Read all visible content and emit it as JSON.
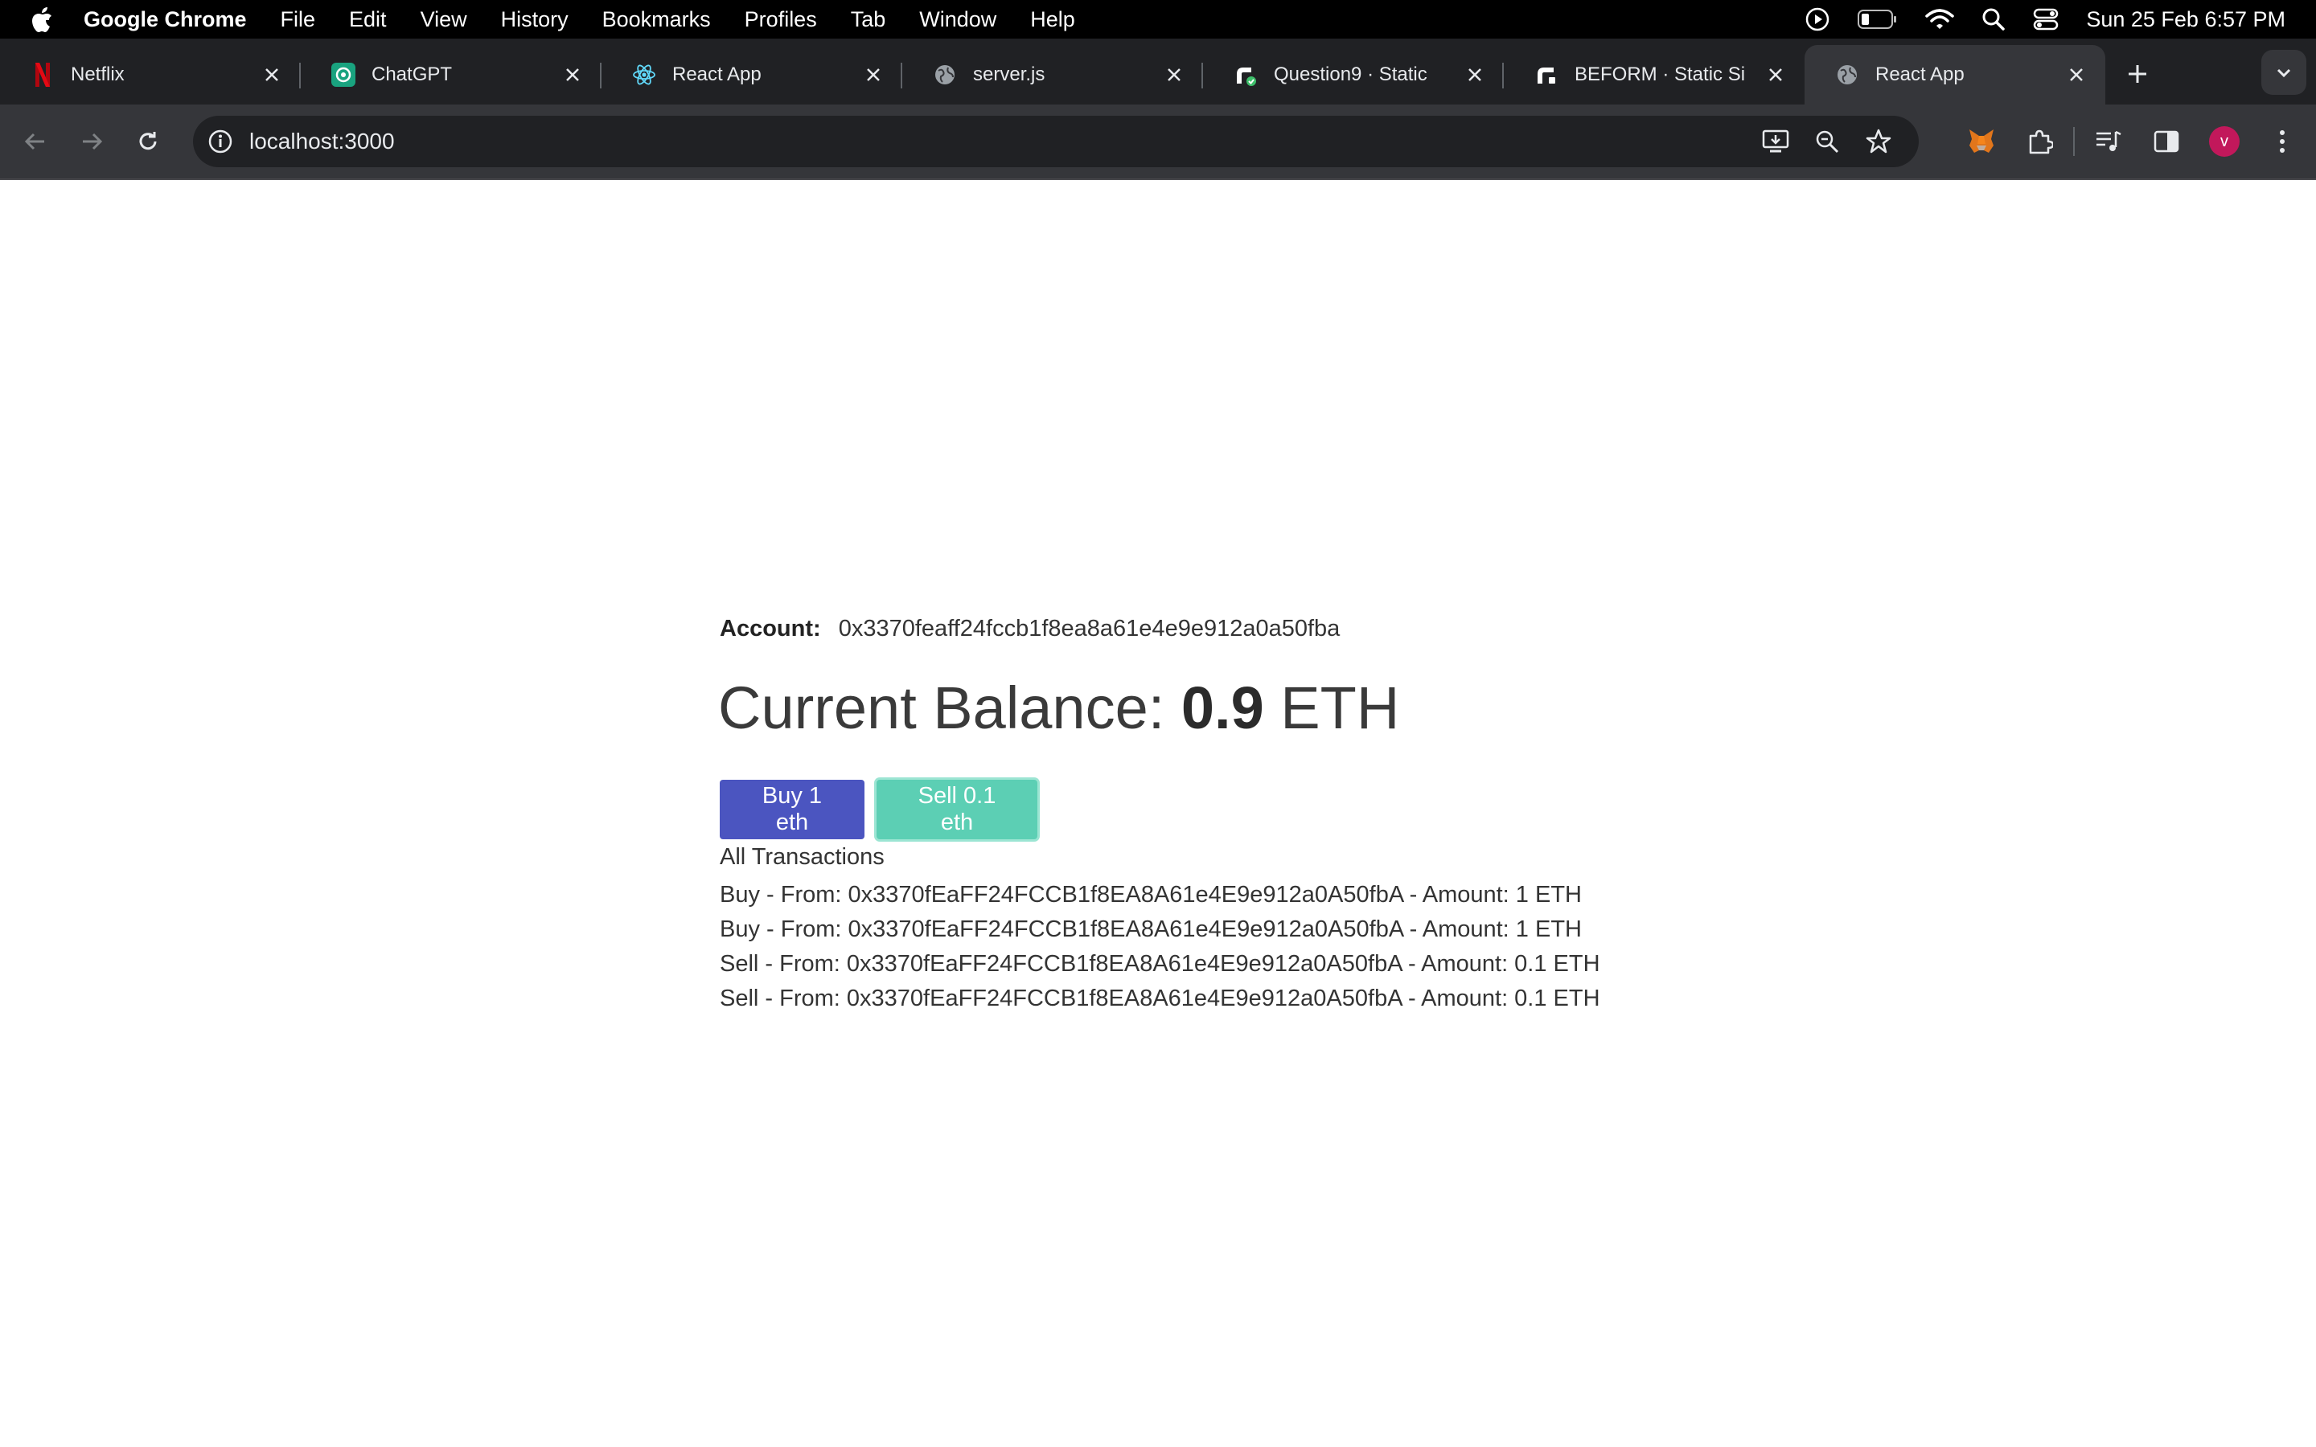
{
  "menubar": {
    "app_name": "Google Chrome",
    "items": [
      "File",
      "Edit",
      "View",
      "History",
      "Bookmarks",
      "Profiles",
      "Tab",
      "Window",
      "Help"
    ],
    "clock": "Sun 25 Feb  6:57 PM"
  },
  "tabs": [
    {
      "title": "Netflix",
      "icon": "netflix-icon",
      "active": false
    },
    {
      "title": "ChatGPT",
      "icon": "chatgpt-icon",
      "active": false
    },
    {
      "title": "React App",
      "icon": "react-icon",
      "active": false
    },
    {
      "title": "server.js",
      "icon": "globe-icon",
      "active": false
    },
    {
      "title": "Question9 · Static",
      "icon": "render-icon",
      "active": false
    },
    {
      "title": "BEFORM · Static Si",
      "icon": "render-icon",
      "active": false
    },
    {
      "title": "React App",
      "icon": "globe-icon",
      "active": true
    }
  ],
  "toolbar": {
    "url": "localhost:3000",
    "profile_initial": "v"
  },
  "app": {
    "account_label": "Account:",
    "account_value": "0x3370feaff24fccb1f8ea8a61e4e9e912a0a50fba",
    "balance_label": "Current Balance:",
    "balance_value": "0.9",
    "balance_unit": "ETH",
    "buy_label": "Buy 1 eth",
    "sell_label": "Sell 0.1 eth",
    "transactions_heading": "All Transactions",
    "transactions": [
      "Buy - From: 0x3370fEaFF24FCCB1f8EA8A61e4E9e912a0A50fbA - Amount: 1 ETH",
      "Buy - From: 0x3370fEaFF24FCCB1f8EA8A61e4E9e912a0A50fbA - Amount: 1 ETH",
      "Sell - From: 0x3370fEaFF24FCCB1f8EA8A61e4E9e912a0A50fbA - Amount: 0.1 ETH",
      "Sell - From: 0x3370fEaFF24FCCB1f8EA8A61e4E9e912a0A50fbA - Amount: 0.1 ETH"
    ]
  },
  "colors": {
    "buy_button": "#4b55c0",
    "sell_button": "#5ccfb4",
    "chrome_dark": "#202124",
    "chrome_toolbar": "#35363a"
  }
}
